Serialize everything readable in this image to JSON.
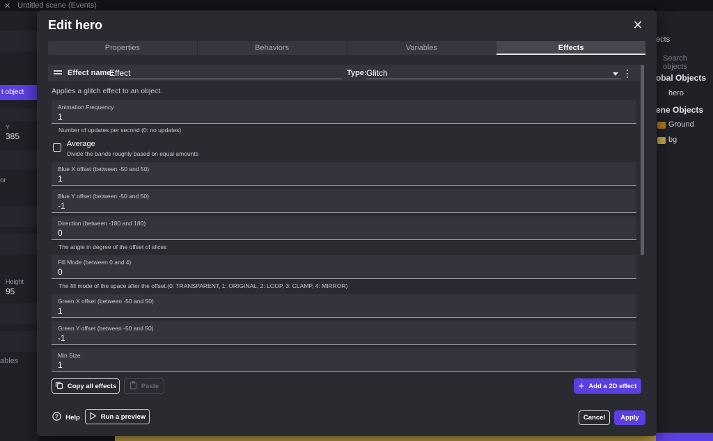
{
  "background": {
    "tab_title": "Untitled scene (Events)",
    "left_panel": {
      "selected_item": "t object",
      "y_label": "Y",
      "y_value": "385",
      "partial_text": "or",
      "height_label": "Height",
      "height_value": "95",
      "variables_label": "ables"
    },
    "right_panel": {
      "title": "ects",
      "search_placeholder": "Search objects",
      "global_objects": "obal Objects",
      "hero": "hero",
      "scene_objects": "ene Objects",
      "ground": "Ground",
      "bg": "bg"
    }
  },
  "dialog": {
    "title": "Edit hero",
    "tabs": [
      "Properties",
      "Behaviors",
      "Variables",
      "Effects"
    ],
    "active_tab": "Effects",
    "effect": {
      "name_label": "Effect name:",
      "name_value": "Effect",
      "type_label": "Type:",
      "type_value": "Glitch",
      "description": "Applies a glitch effect to an object."
    },
    "fields": [
      {
        "label": "Animation Frequency",
        "value": "1",
        "help": "Number of updates per second (0: no updates)"
      },
      {
        "label": "Blue X offset (between -50 and 50)",
        "value": "1",
        "help": ""
      },
      {
        "label": "Blue Y offset (between -50 and 50)",
        "value": "-1",
        "help": ""
      },
      {
        "label": "Direction (between -180 and 180)",
        "value": "0",
        "help": "The angle in degree of the offset of slices"
      },
      {
        "label": "Fill Mode (between 0 and 4)",
        "value": "0",
        "help": "The fill mode of the space after the offset.(0: TRANSPARENT, 1: ORIGINAL, 2: LOOP, 3: CLAMP, 4: MIRROR)"
      },
      {
        "label": "Green X offset (between -50 and 50)",
        "value": "1",
        "help": ""
      },
      {
        "label": "Green Y offset (between -50 and 50)",
        "value": "-1",
        "help": ""
      },
      {
        "label": "Min Size",
        "value": "1",
        "help": ""
      }
    ],
    "average": {
      "label": "Average",
      "help": "Divide the bands roughly based on equal amounts",
      "checked": false
    },
    "buttons": {
      "copy_all": "Copy all effects",
      "paste": "Paste",
      "add_effect": "Add a 2D effect",
      "help": "Help",
      "run_preview": "Run a preview",
      "cancel": "Cancel",
      "apply": "Apply"
    }
  },
  "colors": {
    "accent": "#5b3fe0",
    "dialog_bg": "#2a2a31",
    "field_bg": "#34343c"
  }
}
